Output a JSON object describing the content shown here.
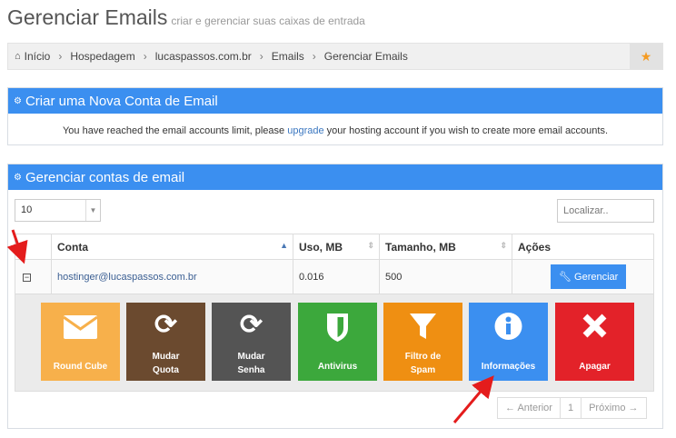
{
  "page": {
    "title": "Gerenciar Emails",
    "subtitle": "criar e gerenciar suas caixas de entrada"
  },
  "breadcrumb": [
    "Início",
    "Hospedagem",
    "lucaspassos.com.br",
    "Emails",
    "Gerenciar Emails"
  ],
  "create_panel": {
    "title": "Criar uma Nova Conta de Email",
    "msg_pre": "You have reached the email accounts limit, please ",
    "msg_link": "upgrade",
    "msg_post": " your hosting account if you wish to create more email accounts."
  },
  "manage_panel": {
    "title": "Gerenciar contas de email",
    "page_size": "10",
    "search_placeholder": "Localizar..",
    "columns": [
      "Conta",
      "Uso, MB",
      "Tamanho, MB",
      "Ações"
    ],
    "row": {
      "account": "hostinger@lucaspassos.com.br",
      "usage": "0.016",
      "size": "500",
      "action": "Gerenciar"
    },
    "tiles": [
      {
        "label": "Round Cube",
        "color": "#f7b04b",
        "icon": "envelope-icon"
      },
      {
        "label": "Mudar Quota",
        "color": "#6b4a2f",
        "icon": "refresh-icon"
      },
      {
        "label": "Mudar Senha",
        "color": "#545454",
        "icon": "refresh-icon"
      },
      {
        "label": "Antivirus",
        "color": "#3ca83c",
        "icon": "shield-icon"
      },
      {
        "label": "Filtro de Spam",
        "color": "#ef8f12",
        "icon": "filter-icon"
      },
      {
        "label": "Informações",
        "color": "#3b8ff0",
        "icon": "info-icon"
      },
      {
        "label": "Apagar",
        "color": "#e32229",
        "icon": "close-icon"
      }
    ],
    "pager": {
      "prev": "← Anterior",
      "page": "1",
      "next": "Próximo →"
    }
  }
}
